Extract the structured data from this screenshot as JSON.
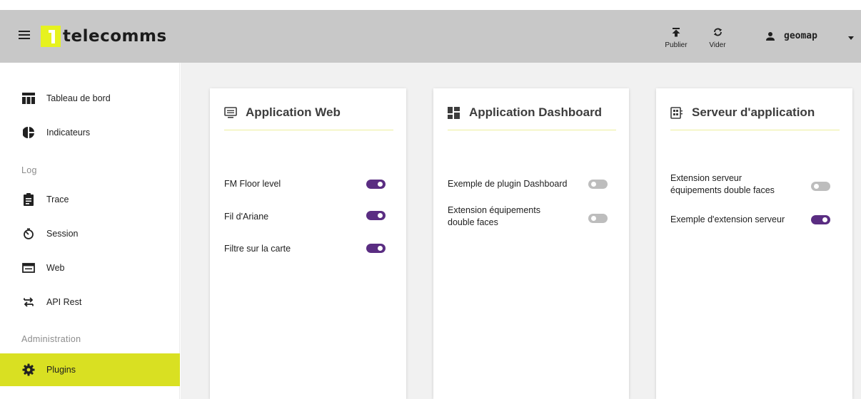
{
  "header": {
    "logo_mark": "1",
    "logo_text": "telecomms",
    "actions": [
      {
        "label": "Publier",
        "icon": "upload-icon"
      },
      {
        "label": "Vider",
        "icon": "refresh-icon"
      }
    ],
    "user": {
      "name": "geomap",
      "icon": "person-icon"
    }
  },
  "sidebar": {
    "items_top": [
      {
        "label": "Tableau de bord",
        "icon": "table-icon"
      },
      {
        "label": "Indicateurs",
        "icon": "pie-chart-icon"
      }
    ],
    "section_log": "Log",
    "items_log": [
      {
        "label": "Trace",
        "icon": "clipboard-icon"
      },
      {
        "label": "Session",
        "icon": "timer-icon"
      },
      {
        "label": "Web",
        "icon": "web-window-icon"
      },
      {
        "label": "API Rest",
        "icon": "swap-arrows-icon"
      }
    ],
    "section_admin": "Administration",
    "items_admin": [
      {
        "label": "Plugins",
        "icon": "gear-icon",
        "active": true
      }
    ]
  },
  "cards": [
    {
      "title": "Application Web",
      "icon": "web-app-icon",
      "plugins": [
        {
          "label": "FM Floor level",
          "enabled": true
        },
        {
          "label": "Fil d'Ariane",
          "enabled": true
        },
        {
          "label": "Filtre sur la carte",
          "enabled": true
        }
      ]
    },
    {
      "title": "Application Dashboard",
      "icon": "dashboard-icon",
      "plugins": [
        {
          "label": "Exemple de plugin Dashboard",
          "enabled": false
        },
        {
          "label_line1": "Extension équipements",
          "label_line2": "double faces",
          "enabled": false
        }
      ]
    },
    {
      "title": "Serveur d'application",
      "icon": "server-app-icon",
      "plugins": [
        {
          "label_line1": "Extension serveur",
          "label_line2": "équipements double faces",
          "enabled": false
        },
        {
          "label": "Exemple d'extension serveur",
          "enabled": true
        }
      ]
    }
  ],
  "colors": {
    "topbar": "#c8c8c8",
    "accent": "#d9e022",
    "toggle_on": "#5a2d82",
    "toggle_off": "#bdbdbd"
  }
}
